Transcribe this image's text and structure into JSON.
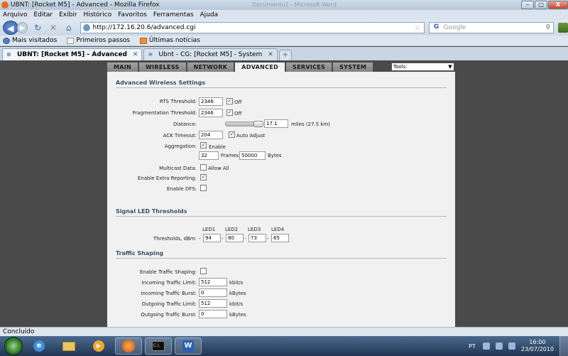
{
  "window": {
    "title": "UBNT: [Rocket M5] - Advanced - Mozilla Firefox",
    "ghost_title": "Documento1 - Microsoft Word",
    "controls": [
      "–",
      "□",
      "X"
    ]
  },
  "menu": [
    "Arquivo",
    "Editar",
    "Exibir",
    "Histórico",
    "Favoritos",
    "Ferramentas",
    "Ajuda"
  ],
  "nav": {
    "url": "http://172.16.20.6/advanced.cgi",
    "search_placeholder": "Google"
  },
  "bookmarks": [
    "Mais visitados",
    "Primeiros passos",
    "Últimas notícias"
  ],
  "tabs": [
    {
      "label": "UBNT: [Rocket M5] - Advanced",
      "active": true
    },
    {
      "label": "Ubnt - CG: [Rocket M5] - System",
      "active": false
    }
  ],
  "page_tabs": [
    "MAIN",
    "WIRELESS",
    "NETWORK",
    "ADVANCED",
    "SERVICES",
    "SYSTEM"
  ],
  "tools": "Tools:",
  "advanced": {
    "title": "Advanced Wireless Settings",
    "rts_label": "RTS Threshold:",
    "rts_value": "2346",
    "rts_off": "Off",
    "frag_label": "Fragmentation Threshold:",
    "frag_value": "2346",
    "frag_off": "Off",
    "distance_label": "Distance:",
    "distance_value": "17.1",
    "distance_unit": "miles (27.5 km)",
    "ack_label": "ACK Timeout:",
    "ack_value": "204",
    "ack_auto": "Auto Adjust",
    "aggregation_label": "Aggregation:",
    "aggregation_enable": "Enable",
    "frames_value": "32",
    "frames_label": "Frames",
    "bytes_value": "50000",
    "bytes_label": "Bytes",
    "multicast_label": "Multicast Data:",
    "multicast_allow": "Allow All",
    "extra_label": "Enable Extra Reporting:",
    "dfs_label": "Enable DFS:"
  },
  "led": {
    "title": "Signal LED Thresholds",
    "headers": [
      "LED1",
      "LED2",
      "LED3",
      "LED4"
    ],
    "label": "Thresholds, dBm:",
    "minus": "-",
    "values": [
      "94",
      "80",
      "73",
      "65"
    ]
  },
  "traffic": {
    "title": "Traffic Shaping",
    "enable_label": "Enable Traffic Shaping:",
    "in_limit_label": "Incoming Traffic Limit:",
    "in_limit_value": "512",
    "in_limit_unit": "kbit/s",
    "in_burst_label": "Incoming Traffic Burst:",
    "in_burst_value": "0",
    "in_burst_unit": "kBytes",
    "out_limit_label": "Outgoing Traffic Limit:",
    "out_limit_value": "512",
    "out_limit_unit": "kbit/s",
    "out_burst_label": "Outgoing Traffic Burst:",
    "out_burst_value": "0",
    "out_burst_unit": "kBytes"
  },
  "status": "Concluído",
  "taskbar": {
    "lang": "PT",
    "time": "16:00",
    "date": "23/07/2010"
  }
}
